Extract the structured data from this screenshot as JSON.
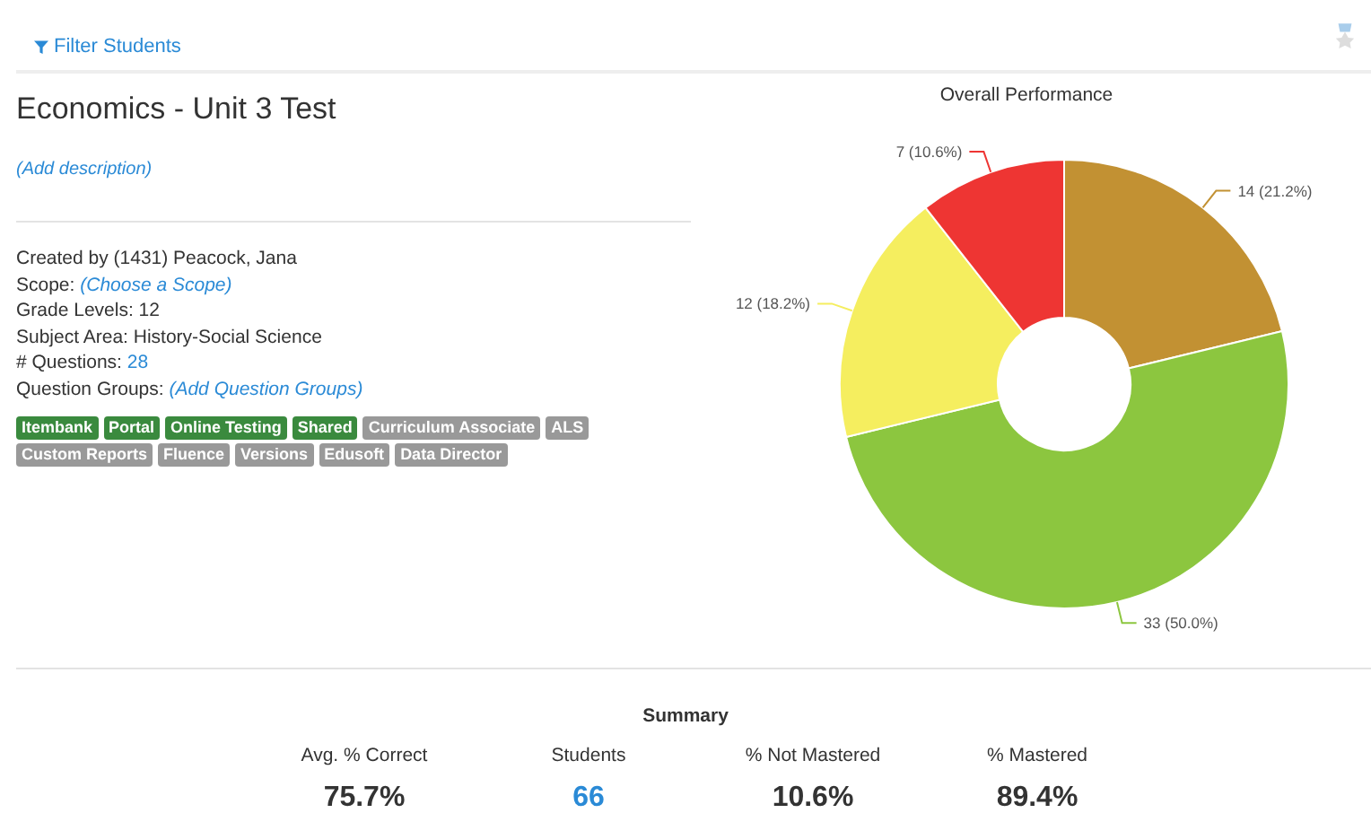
{
  "filter_link": "Filter Students",
  "title": "Economics - Unit 3 Test",
  "description_link": "(Add description)",
  "details": [
    {
      "label": "Created by (1431) Peacock, Jana"
    },
    {
      "label": "Scope: ",
      "link": "(Choose a Scope)",
      "italic": true
    },
    {
      "label": "Grade Levels: 12"
    },
    {
      "label": "Subject Area: History-Social Science"
    },
    {
      "label": "# Questions: ",
      "link": "28",
      "italic": false
    },
    {
      "label": "Question Groups: ",
      "link": "(Add Question Groups)",
      "italic": true
    }
  ],
  "tags": [
    {
      "label": "Itembank",
      "on": true
    },
    {
      "label": "Portal",
      "on": true
    },
    {
      "label": "Online Testing",
      "on": true
    },
    {
      "label": "Shared",
      "on": true
    },
    {
      "label": "Curriculum Associate",
      "on": false
    },
    {
      "label": "ALS",
      "on": false
    },
    {
      "label": "Custom Reports",
      "on": false
    },
    {
      "label": "Fluence",
      "on": false
    },
    {
      "label": "Versions",
      "on": false
    },
    {
      "label": "Edusoft",
      "on": false
    },
    {
      "label": "Data Director",
      "on": false
    }
  ],
  "chart": {
    "chart_data": {
      "type": "donut",
      "title": "Overall Performance",
      "values": [
        14,
        33,
        12,
        7
      ],
      "colors": [
        "#c29133",
        "#8cc63f",
        "#f5ee5f",
        "#ee3533"
      ],
      "value_labels": [
        "14 (21.2%)",
        "33 (50.0%)",
        "12 (18.2%)",
        "7 (10.6%)"
      ]
    }
  },
  "summary": {
    "title": "Summary",
    "stats": [
      {
        "label": "Avg. % Correct",
        "value": "75.7%",
        "link": false
      },
      {
        "label": "Students",
        "value": "66",
        "link": true
      },
      {
        "label": "% Not Mastered",
        "value": "10.6%",
        "link": false
      },
      {
        "label": "% Mastered",
        "value": "89.4%",
        "link": false
      }
    ]
  }
}
